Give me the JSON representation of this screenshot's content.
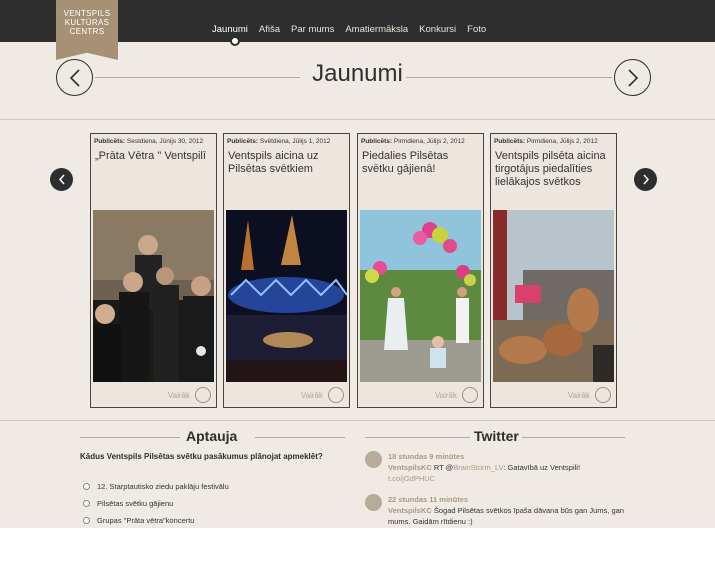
{
  "logo": {
    "lines": [
      "VENTSPILS",
      "KULTŪRAS",
      "CENTRS"
    ]
  },
  "nav": {
    "items": [
      "Jaunumi",
      "Afiša",
      "Par mums",
      "Amatiermāksla",
      "Konkursi",
      "Foto"
    ],
    "active": "Jaunumi"
  },
  "page": {
    "title": "Jaunumi"
  },
  "news": [
    {
      "date_label": "Publicēts:",
      "date": "Sestdiena, Jūnijs 30, 2012",
      "title": "„Prāta Vētra \" Ventspilī",
      "more": "Vairāk"
    },
    {
      "date_label": "Publicēts:",
      "date": "Svētdiena, Jūlijs 1, 2012",
      "title": "Ventspils aicina uz Pilsētas svētkiem",
      "more": "Vairāk"
    },
    {
      "date_label": "Publicēts:",
      "date": "Pirmdiena, Jūlijs 2, 2012",
      "title": "Piedalies Pilsētas svētku gājienā!",
      "more": "Vairāk"
    },
    {
      "date_label": "Publicēts:",
      "date": "Pirmdiena, Jūlijs 2, 2012",
      "title": "Ventspils pilsēta aicina tirgotājus piedalīties lielākajos svētkos",
      "more": "Vairāk"
    }
  ],
  "poll": {
    "heading": "Aptauja",
    "question": "Kādus Ventspils Pilsētas svētku pasākumus plānojat apmeklēt?",
    "options": [
      "12. Starptautisko ziedu paklāju festivālu",
      "Pilsētas svētku gājienu",
      "Grupas \"Prāta vētra\"koncertu"
    ]
  },
  "twitter": {
    "heading": "Twitter",
    "tweets": [
      {
        "time": "18 stundas 9 minūtes",
        "user": "VentspilsKC",
        "pre": " RT @",
        "mention": "BrainStorm_LV",
        "text": ": Gatavībā uz Ventspili! ",
        "link": "t.co/jGdPHUC"
      },
      {
        "time": "22 stundas 11 minūtes",
        "user": "VentspilsKC",
        "pre": "",
        "mention": "",
        "text": " Šogad Pilsētas svētkos īpaša dāvana būs gan Jums, gan mums. Gaidām rītdienu :)",
        "link": ""
      }
    ]
  },
  "colors": {
    "topbar": "#2e2e2e",
    "logo": "#a69174",
    "background": "#efeae3",
    "accent": "#a89a86"
  }
}
